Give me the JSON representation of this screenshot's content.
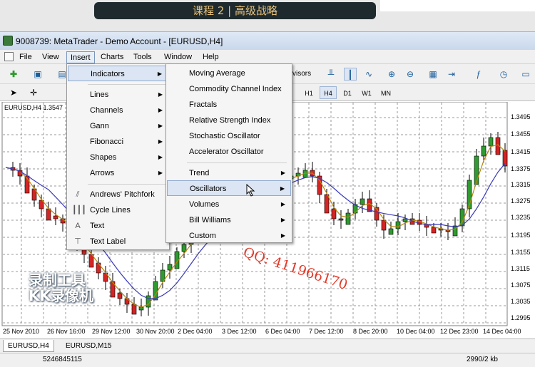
{
  "banner": {
    "text": "课程 2 | 高级战略"
  },
  "window": {
    "title": "9008739: MetaTrader - Demo Account - [EURUSD,H4]"
  },
  "menubar": {
    "items": [
      "File",
      "View",
      "Insert",
      "Charts",
      "Tools",
      "Window",
      "Help"
    ]
  },
  "toolbar": {
    "visors_label": "visors"
  },
  "timeframes": [
    "H1",
    "H4",
    "D1",
    "W1",
    "MN"
  ],
  "timeframe_selected": "H4",
  "insert_menu": {
    "indicators": "Indicators",
    "lines": "Lines",
    "channels": "Channels",
    "gann": "Gann",
    "fibonacci": "Fibonacci",
    "shapes": "Shapes",
    "arrows": "Arrows",
    "pitchfork": "Andrews' Pitchfork",
    "cycle_lines": "Cycle Lines",
    "text": "Text",
    "text_label": "Text Label"
  },
  "indicators_menu": {
    "moving_average": "Moving Average",
    "cci": "Commodity Channel Index",
    "fractals": "Fractals",
    "rsi": "Relative Strength Index",
    "stochastic": "Stochastic Oscillator",
    "accelerator": "Accelerator Oscillator",
    "trend": "Trend",
    "oscillators": "Oscillators",
    "volumes": "Volumes",
    "bill_williams": "Bill Williams",
    "custom": "Custom"
  },
  "chart": {
    "symbol_label": "EURUSD,H4  1.3547",
    "price_labels": [
      "1.3495",
      "1.3455",
      "1.3415",
      "1.3375",
      "1.3315",
      "1.3275",
      "1.3235",
      "1.3195",
      "1.3155",
      "1.3115",
      "1.3075",
      "1.3035",
      "1.2995"
    ],
    "time_labels": [
      "25 Nov 2010",
      "26 Nov 16:00",
      "29 Nov 12:00",
      "30 Nov 20:00",
      "2 Dec 04:00",
      "3 Dec 12:00",
      "6 Dec 04:00",
      "7 Dec 12:00",
      "8 Dec 20:00",
      "10 Dec 04:00",
      "12 Dec 23:00",
      "14 Dec 04:00"
    ],
    "colors": {
      "bull": "#2f9a2f",
      "bear": "#d42424",
      "ma_fast": "#b8860b",
      "ma_slow": "#3a3ab8",
      "grid": "#9a9a9a"
    }
  },
  "tabs": [
    "EURUSD,H4",
    "EURUSD,M15"
  ],
  "active_tab": "EURUSD,H4",
  "status": {
    "left": "5246845115",
    "right": "2990/2 kb"
  },
  "watermarks": {
    "qq": "QQ:    411966170",
    "kk_line1": "录制工具",
    "kk_line2": "KK录像机"
  }
}
